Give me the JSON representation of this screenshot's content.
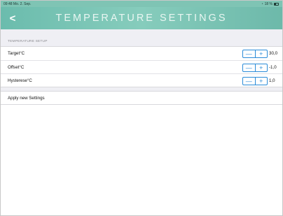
{
  "status_bar": {
    "time_date": "09:48  Mo. 2. Sep.",
    "battery": "18 %"
  },
  "nav": {
    "title": "TEMPERATURE SETTINGS",
    "back_glyph": "<"
  },
  "section": {
    "header": "TEMPERATURE SETUP"
  },
  "settings": [
    {
      "label": "Target°C",
      "value": "30,0"
    },
    {
      "label": "Offset°C",
      "value": "-1,0"
    },
    {
      "label": "Hysterese°C",
      "value": "1,0"
    }
  ],
  "stepper": {
    "minus": "—",
    "plus": "+"
  },
  "apply": {
    "label": "Apply new Settings"
  },
  "icons": {
    "back": "chevron-left-icon",
    "wifi": "wifi-icon",
    "battery": "battery-icon"
  },
  "colors": {
    "header": "#7fc4b4",
    "accent": "#2a8bd8"
  }
}
